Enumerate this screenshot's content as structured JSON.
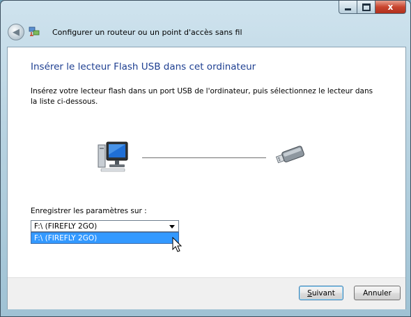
{
  "window": {
    "title": "Configurer un routeur ou un point d'accès sans fil",
    "close_glyph": "x",
    "icons": [
      "minimize-icon",
      "maximize-icon",
      "close-icon",
      "back-arrow-icon",
      "network-wizard-icon"
    ]
  },
  "content": {
    "heading": "Insérer le lecteur Flash USB dans cet ordinateur",
    "description": "Insérez votre lecteur flash dans un port USB de l'ordinateur, puis sélectionnez le lecteur dans la liste ci-dessous.",
    "illustration_icons": [
      "computer-icon",
      "usb-drive-icon"
    ],
    "save_label": "Enregistrer les paramètres sur :",
    "drive_select": {
      "selected": "F:\\  (FIREFLY 2GO)",
      "options": [
        "F:\\  (FIREFLY 2GO)"
      ],
      "highlighted_option": "F:\\  (FIREFLY 2GO)"
    }
  },
  "footer": {
    "next_first": "S",
    "next_rest": "uivant",
    "cancel": "Annuler"
  },
  "colors": {
    "heading": "#1e3f91",
    "highlight": "#3399ff",
    "close_button": "#c8452f"
  }
}
